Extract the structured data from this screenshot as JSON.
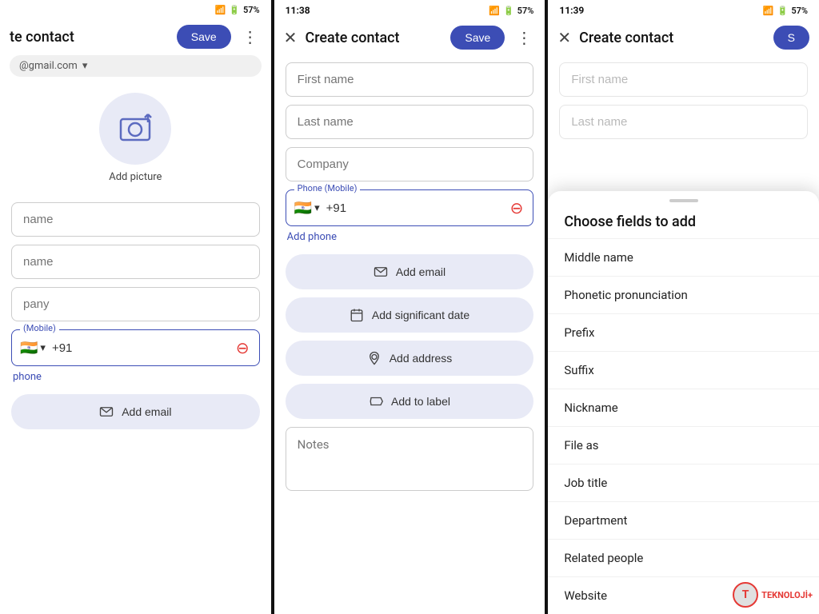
{
  "panel1": {
    "status": {
      "time": "",
      "battery": "57%"
    },
    "header": {
      "title": "te contact",
      "save_label": "Save"
    },
    "account": {
      "email": "@gmail.com"
    },
    "avatar": {
      "label": "Add picture"
    },
    "fields": {
      "first_name": "name",
      "last_name": "name",
      "company": "pany",
      "phone_label": "(Mobile)",
      "phone_code": "+91",
      "add_phone": "phone"
    },
    "actions": {
      "add_email": "Add email"
    }
  },
  "panel2": {
    "status": {
      "time": "11:38",
      "battery": "57%"
    },
    "header": {
      "title": "Create contact",
      "save_label": "Save"
    },
    "fields": {
      "first_name_placeholder": "First name",
      "last_name_placeholder": "Last name",
      "company_placeholder": "Company",
      "phone_label": "Phone (Mobile)",
      "phone_code": "+91",
      "add_phone": "Add phone"
    },
    "actions": {
      "add_email": "Add email",
      "add_date": "Add significant date",
      "add_address": "Add address",
      "add_label": "Add to label"
    },
    "notes_placeholder": "Notes"
  },
  "panel3": {
    "status": {
      "time": "11:39",
      "battery": "57%"
    },
    "header": {
      "title": "Create contact",
      "save_label": "S"
    },
    "fields": {
      "first_name_placeholder": "First name",
      "last_name_placeholder": "Last name"
    },
    "sheet": {
      "title": "Choose fields to add",
      "items": [
        "Middle name",
        "Phonetic pronunciation",
        "Prefix",
        "Suffix",
        "Nickname",
        "File as",
        "Job title",
        "Department",
        "Related people",
        "Website"
      ]
    }
  },
  "watermark": {
    "text": "TEKNOLOJİ+"
  }
}
